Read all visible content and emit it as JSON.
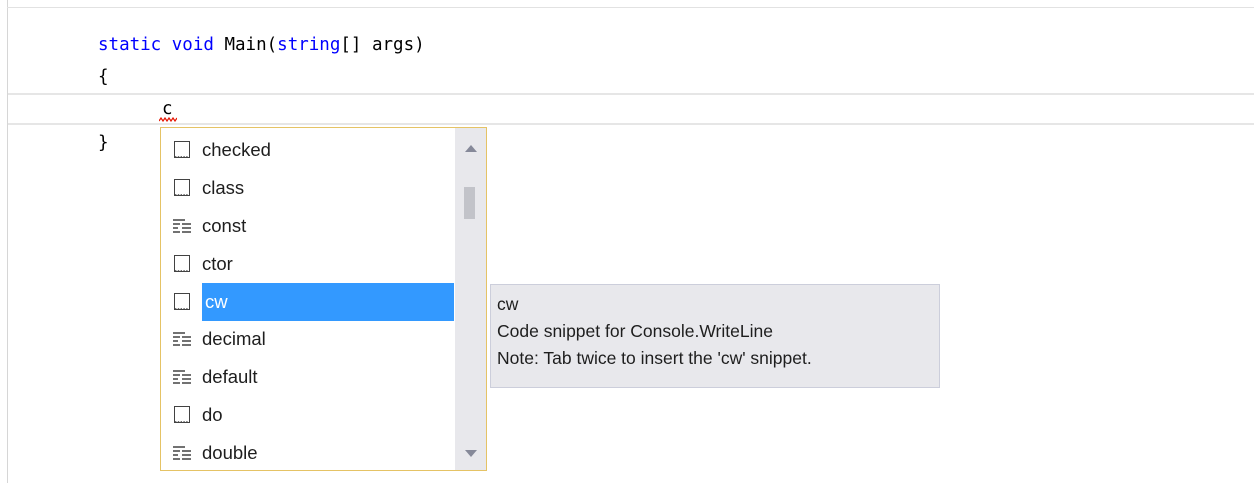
{
  "editor": {
    "line1": {
      "kw1": "static",
      "kw2": "void",
      "name": "Main(",
      "type": "string",
      "rest": "[] args)"
    },
    "open_brace": "{",
    "typed_text": "c",
    "close_brace": "}"
  },
  "completion": {
    "items": [
      {
        "label": "checked",
        "icon": "snippet-icon"
      },
      {
        "label": "class",
        "icon": "snippet-icon"
      },
      {
        "label": "const",
        "icon": "keyword-icon"
      },
      {
        "label": "ctor",
        "icon": "snippet-icon"
      },
      {
        "label": "cw",
        "icon": "snippet-icon",
        "selected": true
      },
      {
        "label": "decimal",
        "icon": "keyword-icon"
      },
      {
        "label": "default",
        "icon": "keyword-icon"
      },
      {
        "label": "do",
        "icon": "snippet-icon"
      },
      {
        "label": "double",
        "icon": "keyword-icon"
      }
    ]
  },
  "tooltip": {
    "title": "cw",
    "description": "Code snippet for Console.WriteLine",
    "note": "Note: Tab twice to insert the 'cw' snippet."
  },
  "colors": {
    "keyword": "#0000ff",
    "selection": "#3399ff",
    "list_border": "#e5c365",
    "squiggle": "#e51400",
    "tooltip_bg": "#e8e8ec"
  }
}
